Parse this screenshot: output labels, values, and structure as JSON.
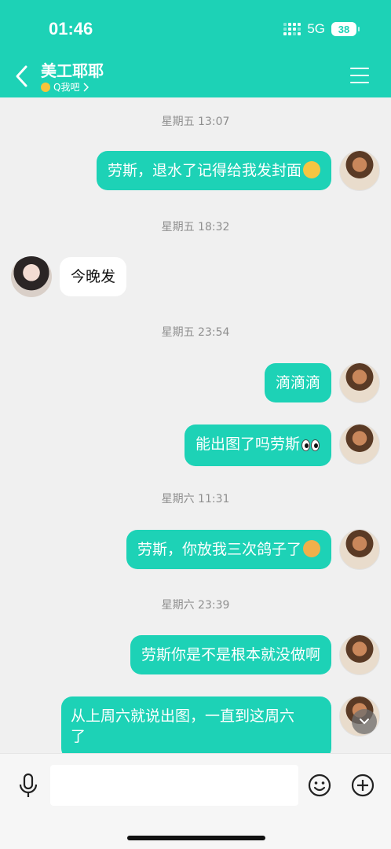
{
  "status_bar": {
    "time": "01:46",
    "network": "5G",
    "battery": "38"
  },
  "header": {
    "title": "美工耶耶",
    "subtitle": "Q我吧"
  },
  "messages": [
    {
      "type": "time",
      "text": "星期五 13:07"
    },
    {
      "type": "msg",
      "from": "me",
      "text": "劳斯，退水了记得给我发封面",
      "emoji": "laugh-cry-emoji"
    },
    {
      "type": "time",
      "text": "星期五 18:32"
    },
    {
      "type": "msg",
      "from": "other",
      "text": "今晚发"
    },
    {
      "type": "time",
      "text": "星期五 23:54"
    },
    {
      "type": "msg",
      "from": "me",
      "text": "滴滴滴"
    },
    {
      "type": "msg",
      "from": "me",
      "text": "能出图了吗劳斯",
      "emoji": "eyes-emoji"
    },
    {
      "type": "time",
      "text": "星期六 11:31"
    },
    {
      "type": "msg",
      "from": "me",
      "text": "劳斯，你放我三次鸽子了",
      "emoji": "dog-face-emoji"
    },
    {
      "type": "time",
      "text": "星期六 23:39"
    },
    {
      "type": "msg",
      "from": "me",
      "text": "劳斯你是不是根本就没做啊"
    },
    {
      "type": "msg",
      "from": "me",
      "text_line1": "从上周六就说出图，一直到这周六",
      "text_line2": "了"
    }
  ],
  "input": {
    "value": "",
    "placeholder": ""
  }
}
